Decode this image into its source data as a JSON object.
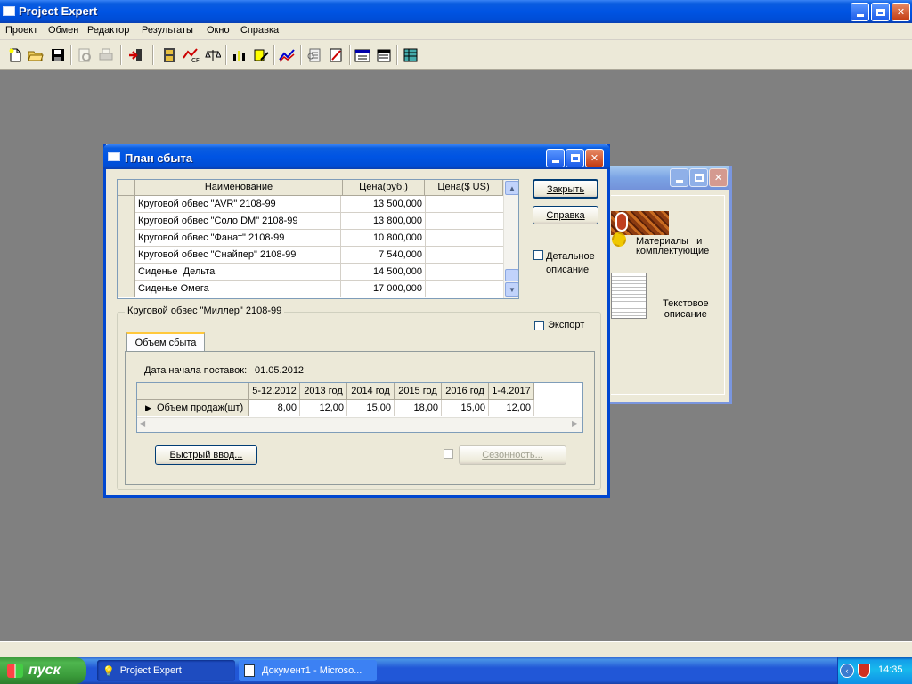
{
  "app": {
    "title": "Project Expert"
  },
  "menu": [
    "Проект",
    "Обмен",
    "Редактор",
    "Результаты",
    "Окно",
    "Справка"
  ],
  "toolbar_icons": [
    "new-icon",
    "open-icon",
    "save-icon",
    "preview-icon",
    "print-icon",
    "exit-icon",
    "module-icon",
    "cashflow-icon",
    "scales-icon",
    "chart-bars-icon",
    "pencil-chart-icon",
    "line-chart-icon",
    "report-icon",
    "book-icon",
    "window-icon",
    "window2-icon",
    "table-icon"
  ],
  "bg_window": {
    "item1": "Материалы   и\nкомплектующие",
    "item2": "Текстовое\nописание"
  },
  "dialog": {
    "title": "План сбыта",
    "grid": {
      "columns": [
        "Наименование",
        "Цена(руб.)",
        "Цена($ US)"
      ],
      "rows": [
        {
          "name": "Круговой обвес \"AVR\" 2108-99",
          "price_rub": "13 500,000",
          "price_usd": ""
        },
        {
          "name": "Круговой обвес \"Соло DM\" 2108-99",
          "price_rub": "13 800,000",
          "price_usd": ""
        },
        {
          "name": "Круговой обвес \"Фанат\" 2108-99",
          "price_rub": "10 800,000",
          "price_usd": ""
        },
        {
          "name": "Круговой обвес \"Снайпер\" 2108-99",
          "price_rub": "7 540,000",
          "price_usd": ""
        },
        {
          "name": "Сиденье  Дельта",
          "price_rub": "14 500,000",
          "price_usd": ""
        },
        {
          "name": "Сиденье Омега",
          "price_rub": "17 000,000",
          "price_usd": ""
        }
      ]
    },
    "close_button": "Закрыть",
    "help_button": "Справка",
    "detail_checkbox": "Детальное\nописание",
    "export_checkbox": "Экспорт",
    "group_label": "Круговой обвес \"Миллер\" 2108-99",
    "tab_label": "Объем сбыта",
    "start_date_label": "Дата начала поставок:",
    "start_date_value": "01.05.2012",
    "sales": {
      "periods": [
        "5-12.2012",
        "2013 год",
        "2014 год",
        "2015 год",
        "2016 год",
        "1-4.2017"
      ],
      "row_label": "Объем продаж(шт)",
      "values": [
        "8,00",
        "12,00",
        "15,00",
        "18,00",
        "15,00",
        "12,00"
      ]
    },
    "quick_input_button": "Быстрый ввод...",
    "seasonality_button": "Сезонность..."
  },
  "taskbar": {
    "start": "пуск",
    "tasks": [
      "Project Expert",
      "Документ1 - Microso..."
    ],
    "clock": "14:35"
  }
}
